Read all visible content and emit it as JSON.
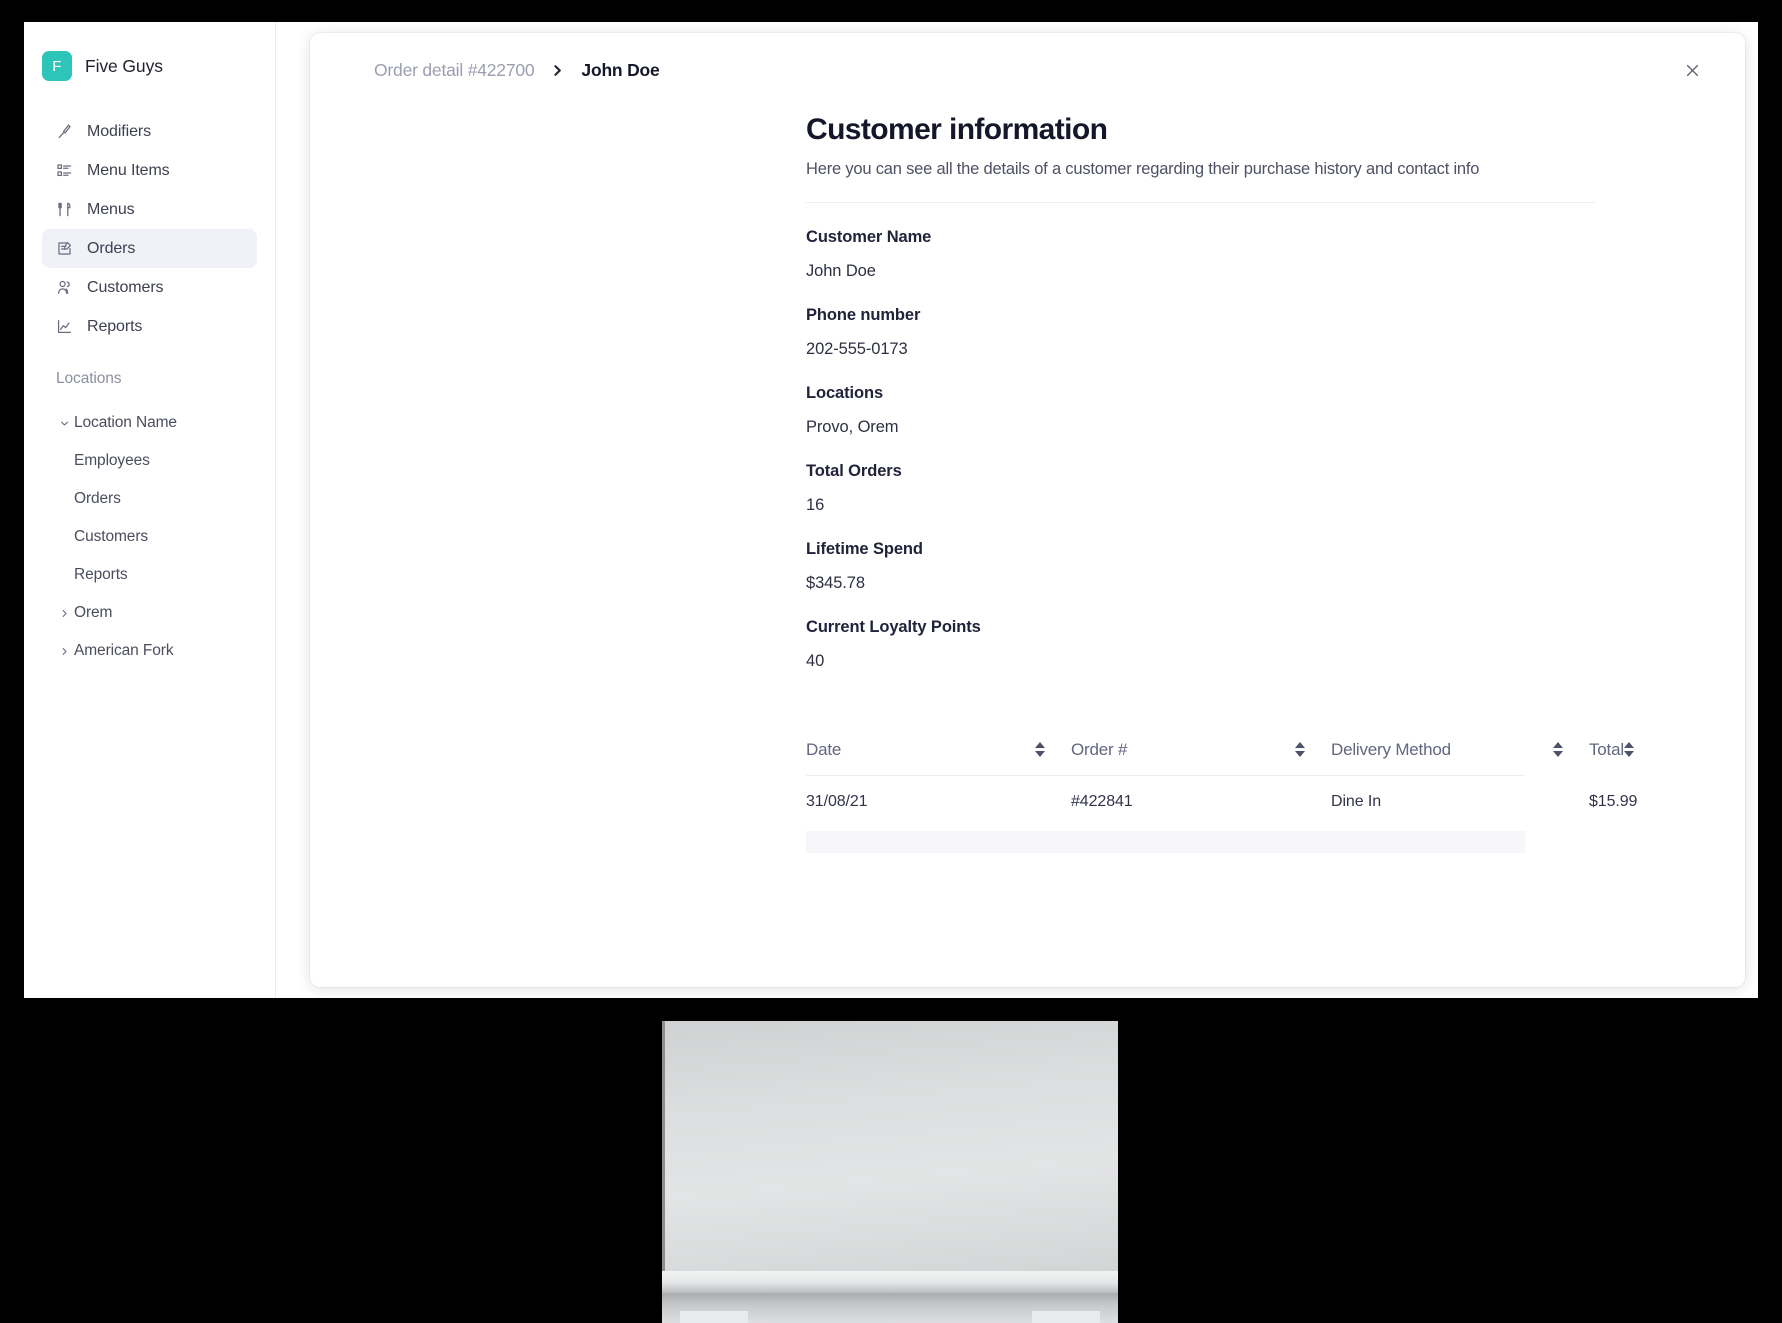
{
  "sidebar": {
    "brand": {
      "logo_letter": "F",
      "name": "Five Guys",
      "logo_color": "#2cc5b7"
    },
    "nav_items": [
      {
        "label": "Modifiers",
        "icon": "knife-icon",
        "active": false
      },
      {
        "label": "Menu Items",
        "icon": "list-icon",
        "active": false
      },
      {
        "label": "Menus",
        "icon": "cutlery-icon",
        "active": false
      },
      {
        "label": "Orders",
        "icon": "order-document-icon",
        "active": true
      },
      {
        "label": "Customers",
        "icon": "people-icon",
        "active": false
      },
      {
        "label": "Reports",
        "icon": "chart-line-icon",
        "active": false
      }
    ],
    "section_label": "Locations",
    "locations": [
      {
        "label": "Location Name",
        "chevron": "chevron-down-icon",
        "indent": false
      },
      {
        "label": "Employees",
        "chevron": "",
        "indent": true
      },
      {
        "label": "Orders",
        "chevron": "",
        "indent": true
      },
      {
        "label": "Customers",
        "chevron": "",
        "indent": true
      },
      {
        "label": "Reports",
        "chevron": "",
        "indent": true
      },
      {
        "label": "Orem",
        "chevron": "chevron-right-icon",
        "indent": false
      },
      {
        "label": "American Fork",
        "chevron": "chevron-right-icon",
        "indent": false
      }
    ]
  },
  "modal": {
    "breadcrumb": {
      "parent": "Order detail #422700",
      "separator": "›",
      "current": "John Doe"
    },
    "close_label": "✕",
    "title": "Customer information",
    "subtitle": "Here you can see all the details of a customer regarding their purchase history and contact info",
    "fields": [
      {
        "label": "Customer Name",
        "value": "John Doe"
      },
      {
        "label": "Phone number",
        "value": "202-555-0173"
      },
      {
        "label": "Locations",
        "value": "Provo, Orem"
      },
      {
        "label": "Total Orders",
        "value": "16"
      },
      {
        "label": "Lifetime Spend",
        "value": "$345.78"
      },
      {
        "label": "Current Loyalty Points",
        "value": "40"
      }
    ],
    "orders_table": {
      "columns": [
        "Date",
        "Order #",
        "Delivery Method",
        "Total"
      ],
      "rows": [
        {
          "date": "31/08/21",
          "order": "#422841",
          "delivery": "Dine In",
          "total": "$15.99"
        }
      ]
    }
  }
}
